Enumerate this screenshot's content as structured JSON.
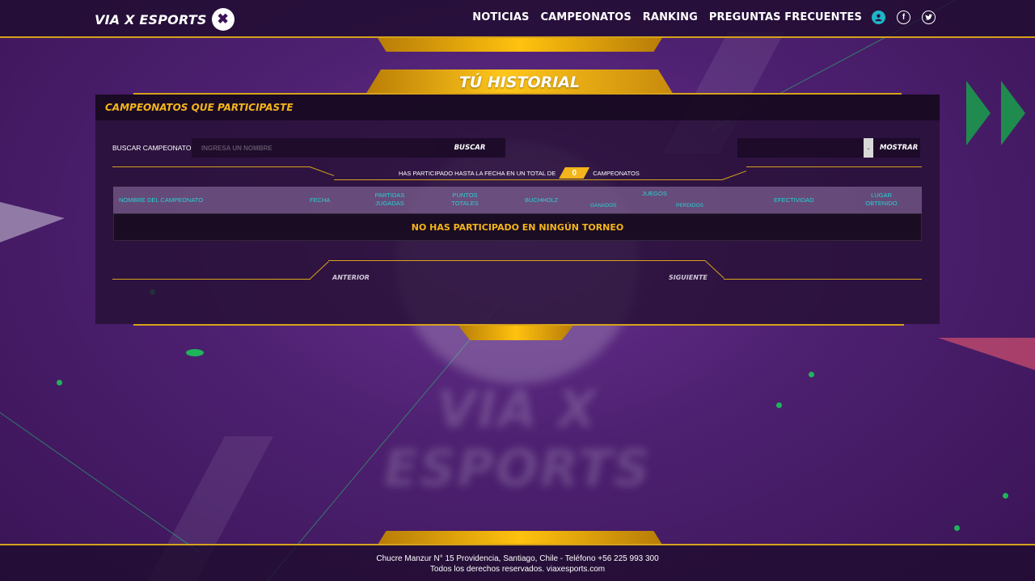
{
  "header": {
    "logo_text": "VIA X ESPORTS",
    "logo_badge": "✖",
    "nav": [
      "NOTICIAS",
      "CAMPEONATOS",
      "RANKING",
      "PREGUNTAS FRECUENTES"
    ],
    "icons": [
      "user-icon",
      "facebook-icon",
      "twitter-icon"
    ]
  },
  "page": {
    "title": "TÚ HISTORIAL"
  },
  "panel": {
    "heading": "CAMPEONATOS QUE PARTICIPASTE",
    "search_label": "BUSCAR CAMPEONATO",
    "search_placeholder": "INGRESA UN NOMBRE",
    "search_button": "BUSCAR",
    "show_button": "MOSTRAR",
    "stat_prefix": "HAS PARTICIPADO HASTA LA FECHA EN UN TOTAL DE",
    "stat_count": "0",
    "stat_suffix": "CAMPEONATOS",
    "columns": {
      "nombre": "NOMBRE DEL CAMPEONATO",
      "fecha": "FECHA",
      "partidas": "PARTIDAS\nJUGADAS",
      "puntos": "PUNTOS\nTOTALES",
      "buchholz": "BUCHHOLZ",
      "juegos": "JUEGOS",
      "ganados": "GANADOS",
      "perdidos": "PERDIDOS",
      "efectividad": "EFECTIVIDAD",
      "lugar": "LUGAR\nOBTENIDO"
    },
    "empty_message": "NO HAS PARTICIPADO EN NINGÚN TORNEO",
    "prev_button": "ANTERIOR",
    "next_button": "SIGUIENTE"
  },
  "footer": {
    "line1": "Chucre Manzur N° 15 Providencia, Santiago, Chile - Teléfono +56 225 993 300",
    "line2": "Todos los derechos reservados. viaxesports.com"
  },
  "colors": {
    "accent": "#f4b51a",
    "teal": "#27d2d2",
    "background": "#4a1f6e"
  }
}
